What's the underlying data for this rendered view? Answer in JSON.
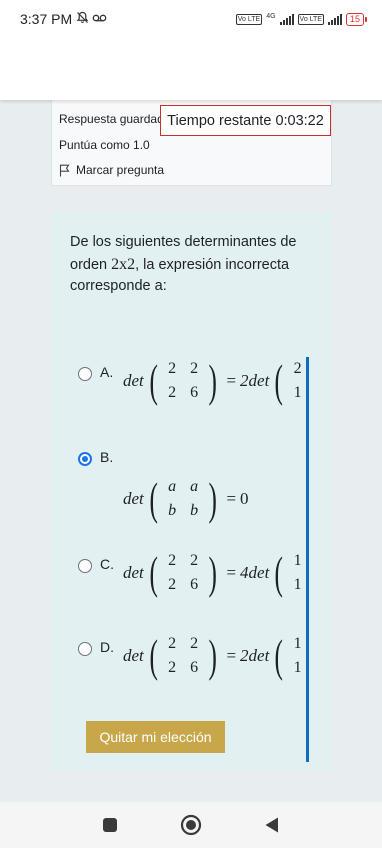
{
  "status_bar": {
    "time": "3:37 PM",
    "left_icons": [
      "mute-icon",
      "voicemail-icon"
    ],
    "network_tag_1": "Vo LTE",
    "network_type": "4G",
    "network_tag_2": "Vo LTE",
    "battery": "15"
  },
  "question_info": {
    "status": "Respuesta guardada",
    "marks": "Puntúa como 1.0",
    "flag_label": "Marcar pregunta"
  },
  "timer": {
    "label": "Tiempo restante",
    "value": "0:03:22",
    "border_color": "#c9302c"
  },
  "question": {
    "text_before": "De los siguientes determinantes de orden ",
    "math": "2x2",
    "text_after": ", la expresión incorrecta corresponde a:",
    "answers": [
      {
        "letter": "A.",
        "selected": false,
        "lhs": [
          "2",
          "2",
          "2",
          "6"
        ],
        "rhs": "2det",
        "rhs_vector": [
          "2",
          "1"
        ]
      },
      {
        "letter": "B.",
        "selected": true,
        "lhs": [
          "a",
          "a",
          "b",
          "b"
        ],
        "rhs": "0"
      },
      {
        "letter": "C.",
        "selected": false,
        "lhs": [
          "2",
          "2",
          "2",
          "6"
        ],
        "rhs": "4det",
        "rhs_vector": [
          "1",
          "1"
        ]
      },
      {
        "letter": "D.",
        "selected": false,
        "lhs": [
          "2",
          "2",
          "2",
          "6"
        ],
        "rhs": "2det",
        "rhs_vector": [
          "1",
          "1"
        ]
      }
    ],
    "det_label": "det",
    "clear_button": "Quitar mi elección"
  },
  "colors": {
    "accent_blue": "#0f6cbf",
    "button_gold": "#c8a64a",
    "question_bg": "#e3f0f2"
  },
  "nav": [
    "square-recents-icon",
    "home-circle-icon",
    "back-triangle-icon"
  ]
}
